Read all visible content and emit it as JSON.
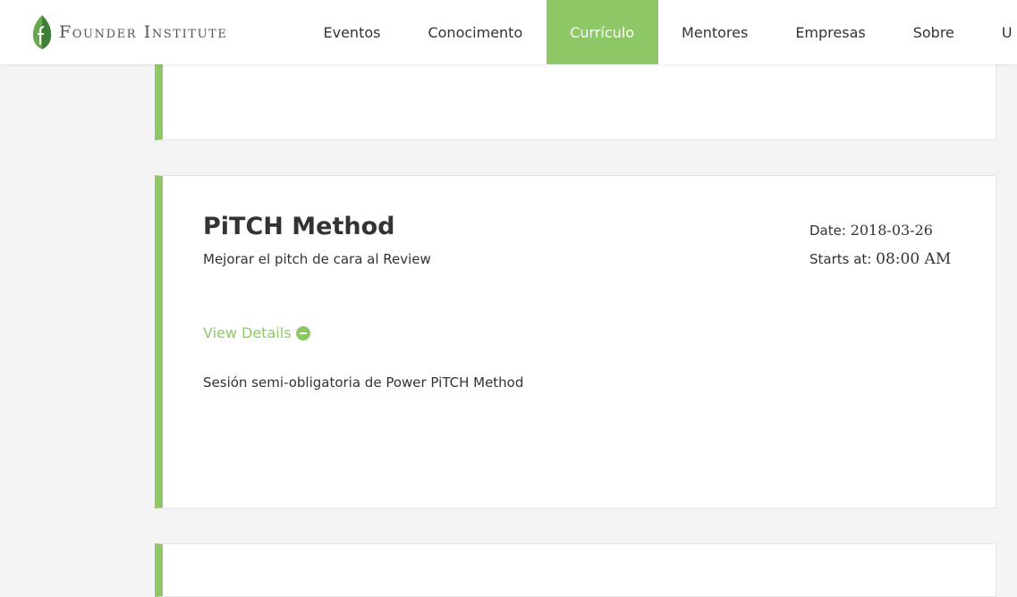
{
  "logo": {
    "text": "Founder Institute",
    "icon": "leaf-logo-icon"
  },
  "nav": {
    "items": [
      {
        "label": "Eventos",
        "active": false
      },
      {
        "label": "Conocimento",
        "active": false
      },
      {
        "label": "Currículo",
        "active": true
      },
      {
        "label": "Mentores",
        "active": false
      },
      {
        "label": "Empresas",
        "active": false
      },
      {
        "label": "Sobre",
        "active": false
      },
      {
        "label": "U",
        "active": false
      }
    ]
  },
  "event": {
    "title": "PiTCH Method",
    "subtitle": "Mejorar el pitch de cara al Review",
    "date_label": "Date:",
    "date_value": "2018-03-26",
    "starts_label": "Starts at:",
    "starts_value": "08:00 AM",
    "view_details": "View Details",
    "view_details_icon": "minus-circle-icon",
    "description": "Sesión semi-obligatoria de Power PiTCH Method"
  },
  "colors": {
    "accent": "#8ec766",
    "background": "#f4f4f4",
    "text": "#333333"
  }
}
